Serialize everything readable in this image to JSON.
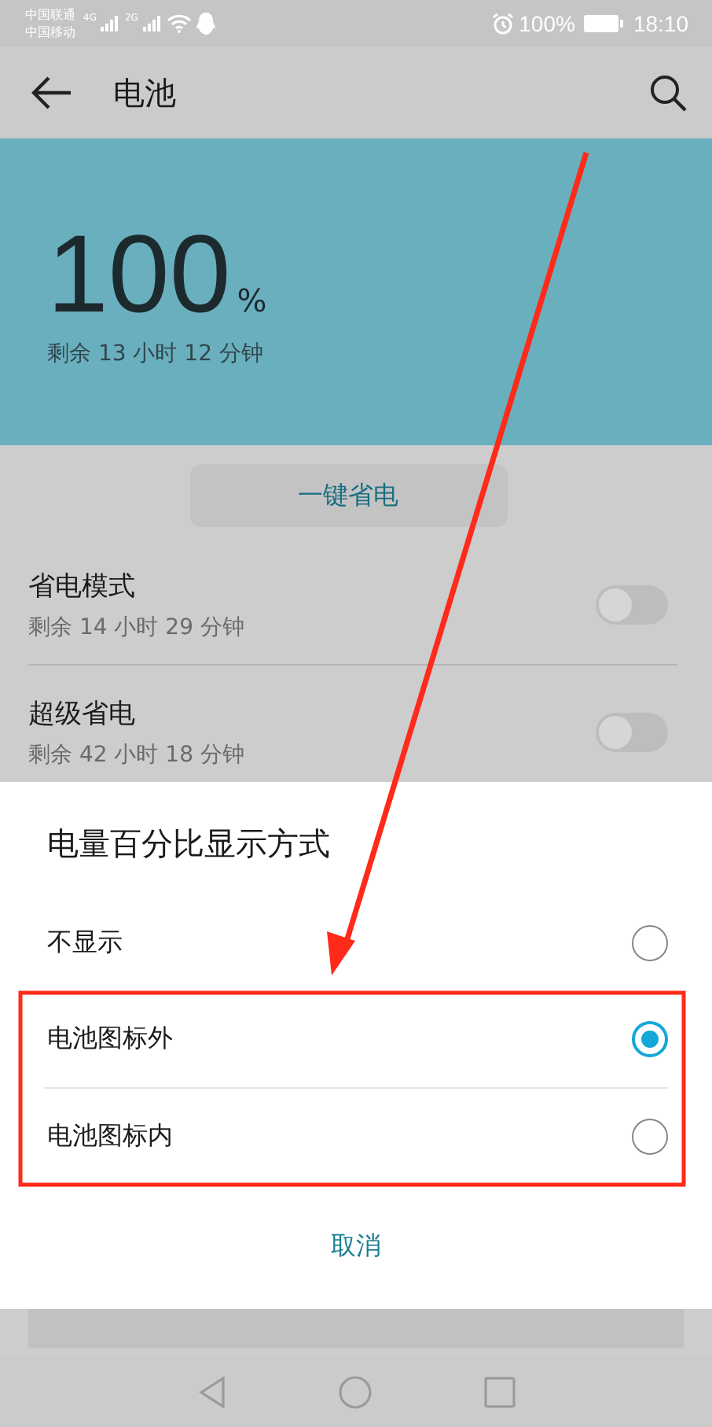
{
  "status_bar": {
    "carriers": [
      "中国联通",
      "中国移动"
    ],
    "network_labels": [
      "4G",
      "2G"
    ],
    "battery_percent": "100%",
    "time": "18:10"
  },
  "app_bar": {
    "title": "电池"
  },
  "summary": {
    "percent": "100",
    "unit": "%",
    "remaining": "剩余 13 小时 12 分钟"
  },
  "optimize_button": "一键省电",
  "modes": [
    {
      "title": "省电模式",
      "subtitle": "剩余 14 小时 29 分钟",
      "on": false
    },
    {
      "title": "超级省电",
      "subtitle": "剩余 42 小时 18 分钟",
      "on": false
    }
  ],
  "dialog": {
    "title": "电量百分比显示方式",
    "options": [
      {
        "label": "不显示",
        "selected": false
      },
      {
        "label": "电池图标外",
        "selected": true
      },
      {
        "label": "电池图标内",
        "selected": false
      }
    ],
    "cancel": "取消"
  }
}
